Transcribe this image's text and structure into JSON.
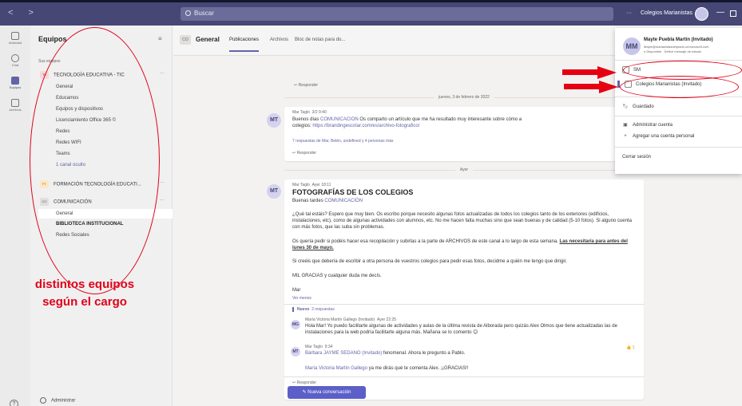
{
  "topbar": {
    "search_placeholder": "Buscar",
    "org": "Colegios Marianistas",
    "dots": "···",
    "min": "—"
  },
  "rail": [
    {
      "label": "Actividad"
    },
    {
      "label": "Chat"
    },
    {
      "label": "Equipos"
    },
    {
      "label": "Archivos"
    }
  ],
  "rail_help": "?",
  "teams": {
    "heading": "Equipos",
    "filter": "≡",
    "your_teams": "Sus equipos",
    "t1": {
      "abbr": "TE",
      "name": "TECNOLOGÍA EDUCATIVA - TIC",
      "more": "···"
    },
    "t1_channels": [
      "General",
      "Educamos",
      "Equipos y dispositivos",
      "Licenciamiento Office 365 ©",
      "Redes",
      "Redes WIFI",
      "Teams"
    ],
    "t1_hidden": "1 canal oculto",
    "t2": {
      "abbr": "FT",
      "name": "FORMACIÓN TECNOLOGÍA EDUCATI...",
      "more": "···"
    },
    "t3": {
      "abbr": "CO",
      "name": "COMUNICACIÓN",
      "more": "···"
    },
    "t3_channels": [
      "General",
      "BIBLIOTECA INSTITUCIONAL",
      "Redes Sociales"
    ],
    "admin": "Administrar"
  },
  "annotation": {
    "line1": "distintos equipos",
    "line2": "según el cargo"
  },
  "channel": {
    "abbr": "CO",
    "title": "General",
    "tabs": [
      "Publicaciones",
      "Archivos",
      "Bloc de notas para do..."
    ]
  },
  "feed": {
    "reply_label": "Responder",
    "date1": "jueves, 3 de febrero de 2022",
    "m1": {
      "initials": "MT",
      "author": "Mar Taglo",
      "time": "3/2 9:40",
      "t1": "Buenos días ",
      "mention": "COMUNICACIÓN",
      "t2": " Os comparto un artículo que me ha resultado muy interesante sobre cómo a",
      "t3": "colegios: ",
      "url": "https://brandingescolar.com/es/archivo-fotografico/",
      "replies": "7 respuestas de Mar, Belén, undefined y 4 personas más"
    },
    "date2": "Ayer",
    "m2": {
      "initials": "MT",
      "author": "Mar Taglo",
      "time": "Ayer 18:11",
      "subject": "FOTOGRAFÍAS DE LOS COLEGIOS",
      "greet": "Buenas tardes ",
      "mention": "COMUNICACIÓN",
      "p1": "¿Qué tal estáis? Espero que muy bien. Os escribo porque necesito algunas fotos actualizadas de todos los colegios tanto de los exteriores (edificios, instalaciones, etc), como de algunas actividades con alumnos, etc. No me hacen falta muchas sino que sean buenas y de calidad (5-10 fotos). Si alguno cuenta con más fotos, que las suba sin problemas.",
      "p2a": "Os quería pedir si podéis hacer esa recopilación y subirlas a la parte de ARCHIVOS de este canal a lo largo de esta semana. ",
      "p2b": "Las necesitaría para antes del lunes 30 de mayo.",
      "p3": "Si creéis que debería de escribir a otra persona de vuestros colegios para pedir esas fotos, decidme a quién me tengo que dirigir.",
      "p4": "MIL GRACIAS y cualquier duda me decís.",
      "sign": "Mar",
      "see_less": "Ver menos"
    },
    "new_badge": "Nuevo",
    "new_replies": "2 respuestas",
    "r1": {
      "initials": "MG",
      "author": "María Victoria Martín Gallego (Invitado)",
      "time": "Ayer 22:25",
      "text": "Hola Mar! Yo puedo facilitarte algunas de actividades  y aulas de la última revista de Alborada pero quizás Alex Olmos que tiene actualizadas las de instalaciones para la web podría facilitarte alguna más. Mañana se lo comento 😊"
    },
    "r2": {
      "initials": "MT",
      "author": "Mar Taglo",
      "time": "9:34",
      "mention": "Bárbara JAYME SEDANO (Invitado)",
      "t1": " fenomenal. Ahora le pregunto a Pablo.",
      "mention2": "María Victoria Martín Gallego",
      "t2": " ya me dirás qué te comenta Alex. ¡¡GRACIAS!!",
      "likes": "👍 1"
    },
    "new_conv": "Nueva conversación"
  },
  "profile": {
    "initials": "MM",
    "name": "Mayte Puebla Martín (Invitado)",
    "email": "Mayte@marianistasdelprado.onmicrosoft.com",
    "status": "Disponible",
    "status_msg": "Definir mensaje de estado",
    "org1": "SM",
    "org2": "Colegios Marianistas (Invitado)",
    "saved": "Guardado",
    "manage": "Administrar cuenta",
    "add": "Agregar una cuenta personal",
    "signout": "Cerrar sesión"
  }
}
